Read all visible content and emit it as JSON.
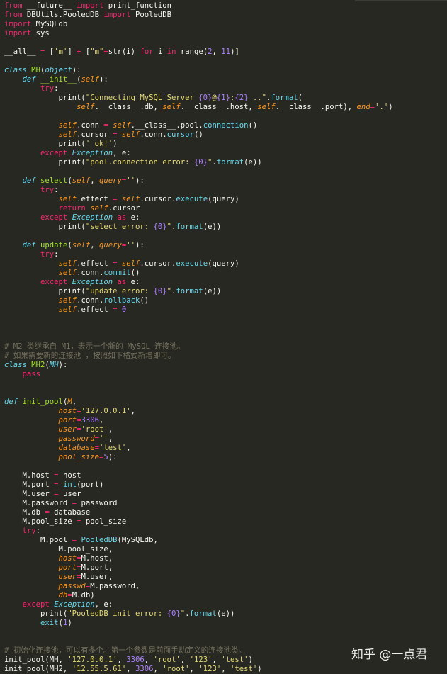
{
  "editor": {
    "theme": "monokai",
    "colors": {
      "background": "#272822",
      "keyword": "#f92672",
      "function": "#a6e22e",
      "builtin": "#66d9ef",
      "string": "#e6db74",
      "number": "#ae81ff",
      "self": "#fd971f",
      "comment": "#75715e",
      "text": "#f8f8f2"
    },
    "lines": [
      [
        [
          "kw",
          "from"
        ],
        [
          "pl",
          " __future__ "
        ],
        [
          "kw",
          "import"
        ],
        [
          "pl",
          " print_function"
        ]
      ],
      [
        [
          "kw",
          "from"
        ],
        [
          "pl",
          " DBUtils.PooledDB "
        ],
        [
          "kw",
          "import"
        ],
        [
          "pl",
          " PooledDB"
        ]
      ],
      [
        [
          "kw",
          "import"
        ],
        [
          "pl",
          " MySQLdb"
        ]
      ],
      [
        [
          "kw",
          "import"
        ],
        [
          "pl",
          " sys"
        ]
      ],
      [],
      [
        [
          "pl",
          "__all__ "
        ],
        [
          "op",
          "="
        ],
        [
          "pl",
          " ["
        ],
        [
          "str",
          "'m'"
        ],
        [
          "pl",
          "] "
        ],
        [
          "op",
          "+"
        ],
        [
          "pl",
          " ["
        ],
        [
          "str",
          "\"m\""
        ],
        [
          "op",
          "+"
        ],
        [
          "pl",
          "str(i) "
        ],
        [
          "kw",
          "for"
        ],
        [
          "pl",
          " i "
        ],
        [
          "kw",
          "in"
        ],
        [
          "pl",
          " range("
        ],
        [
          "num",
          "2"
        ],
        [
          "pl",
          ", "
        ],
        [
          "num",
          "11"
        ],
        [
          "pl",
          ")]"
        ]
      ],
      [],
      [
        [
          "cls",
          "class"
        ],
        [
          "pl",
          " "
        ],
        [
          "fn",
          "MH"
        ],
        [
          "pl",
          "("
        ],
        [
          "cls",
          "object"
        ],
        [
          "pl",
          "):"
        ]
      ],
      [
        [
          "pl",
          "    "
        ],
        [
          "cls",
          "def"
        ],
        [
          "pl",
          " "
        ],
        [
          "fn",
          "__init__"
        ],
        [
          "pl",
          "("
        ],
        [
          "slf",
          "self"
        ],
        [
          "pl",
          "):"
        ]
      ],
      [
        [
          "pl",
          "        "
        ],
        [
          "kw",
          "try"
        ],
        [
          "pl",
          ":"
        ]
      ],
      [
        [
          "pl",
          "            print("
        ],
        [
          "str",
          "\"Connecting MySQL Server "
        ],
        [
          "ph",
          "{0}"
        ],
        [
          "str",
          "@"
        ],
        [
          "ph",
          "{1}"
        ],
        [
          "str",
          ":"
        ],
        [
          "ph",
          "{2}"
        ],
        [
          "str",
          " ..\""
        ],
        [
          "pl",
          "."
        ],
        [
          "bi",
          "format"
        ],
        [
          "pl",
          "("
        ]
      ],
      [
        [
          "pl",
          "                "
        ],
        [
          "slf",
          "self"
        ],
        [
          "pl",
          ".__class__.db, "
        ],
        [
          "slf",
          "self"
        ],
        [
          "pl",
          ".__class__.host, "
        ],
        [
          "slf",
          "self"
        ],
        [
          "pl",
          ".__class__.port), "
        ],
        [
          "prm",
          "end"
        ],
        [
          "op",
          "="
        ],
        [
          "str",
          "'.'"
        ],
        [
          "pl",
          ")"
        ]
      ],
      [],
      [
        [
          "pl",
          "            "
        ],
        [
          "slf",
          "self"
        ],
        [
          "pl",
          ".conn "
        ],
        [
          "op",
          "="
        ],
        [
          "pl",
          " "
        ],
        [
          "slf",
          "self"
        ],
        [
          "pl",
          ".__class__.pool."
        ],
        [
          "bi",
          "connection"
        ],
        [
          "pl",
          "()"
        ]
      ],
      [
        [
          "pl",
          "            "
        ],
        [
          "slf",
          "self"
        ],
        [
          "pl",
          ".cursor "
        ],
        [
          "op",
          "="
        ],
        [
          "pl",
          " "
        ],
        [
          "slf",
          "self"
        ],
        [
          "pl",
          ".conn."
        ],
        [
          "bi",
          "cursor"
        ],
        [
          "pl",
          "()"
        ]
      ],
      [
        [
          "pl",
          "            print("
        ],
        [
          "str",
          "' ok!'"
        ],
        [
          "pl",
          ")"
        ]
      ],
      [
        [
          "pl",
          "        "
        ],
        [
          "kw",
          "except"
        ],
        [
          "pl",
          " "
        ],
        [
          "cls",
          "Exception"
        ],
        [
          "pl",
          ", e:"
        ]
      ],
      [
        [
          "pl",
          "            print("
        ],
        [
          "str",
          "\"pool.connection error: "
        ],
        [
          "ph",
          "{0}"
        ],
        [
          "str",
          "\""
        ],
        [
          "pl",
          "."
        ],
        [
          "bi",
          "format"
        ],
        [
          "pl",
          "(e))"
        ]
      ],
      [],
      [
        [
          "pl",
          "    "
        ],
        [
          "cls",
          "def"
        ],
        [
          "pl",
          " "
        ],
        [
          "fn",
          "select"
        ],
        [
          "pl",
          "("
        ],
        [
          "slf",
          "self"
        ],
        [
          "pl",
          ", "
        ],
        [
          "prm",
          "query"
        ],
        [
          "op",
          "="
        ],
        [
          "str",
          "''"
        ],
        [
          "pl",
          "):"
        ]
      ],
      [
        [
          "pl",
          "        "
        ],
        [
          "kw",
          "try"
        ],
        [
          "pl",
          ":"
        ]
      ],
      [
        [
          "pl",
          "            "
        ],
        [
          "slf",
          "self"
        ],
        [
          "pl",
          ".effect "
        ],
        [
          "op",
          "="
        ],
        [
          "pl",
          " "
        ],
        [
          "slf",
          "self"
        ],
        [
          "pl",
          ".cursor."
        ],
        [
          "bi",
          "execute"
        ],
        [
          "pl",
          "(query)"
        ]
      ],
      [
        [
          "pl",
          "            "
        ],
        [
          "kw",
          "return"
        ],
        [
          "pl",
          " "
        ],
        [
          "slf",
          "self"
        ],
        [
          "pl",
          ".cursor"
        ]
      ],
      [
        [
          "pl",
          "        "
        ],
        [
          "kw",
          "except"
        ],
        [
          "pl",
          " "
        ],
        [
          "cls",
          "Exception"
        ],
        [
          "pl",
          " "
        ],
        [
          "kw",
          "as"
        ],
        [
          "pl",
          " e:"
        ]
      ],
      [
        [
          "pl",
          "            print("
        ],
        [
          "str",
          "\"select error: "
        ],
        [
          "ph",
          "{0}"
        ],
        [
          "str",
          "\""
        ],
        [
          "pl",
          "."
        ],
        [
          "bi",
          "format"
        ],
        [
          "pl",
          "(e))"
        ]
      ],
      [],
      [
        [
          "pl",
          "    "
        ],
        [
          "cls",
          "def"
        ],
        [
          "pl",
          " "
        ],
        [
          "fn",
          "update"
        ],
        [
          "pl",
          "("
        ],
        [
          "slf",
          "self"
        ],
        [
          "pl",
          ", "
        ],
        [
          "prm",
          "query"
        ],
        [
          "op",
          "="
        ],
        [
          "str",
          "''"
        ],
        [
          "pl",
          "):"
        ]
      ],
      [
        [
          "pl",
          "        "
        ],
        [
          "kw",
          "try"
        ],
        [
          "pl",
          ":"
        ]
      ],
      [
        [
          "pl",
          "            "
        ],
        [
          "slf",
          "self"
        ],
        [
          "pl",
          ".effect "
        ],
        [
          "op",
          "="
        ],
        [
          "pl",
          " "
        ],
        [
          "slf",
          "self"
        ],
        [
          "pl",
          ".cursor."
        ],
        [
          "bi",
          "execute"
        ],
        [
          "pl",
          "(query)"
        ]
      ],
      [
        [
          "pl",
          "            "
        ],
        [
          "slf",
          "self"
        ],
        [
          "pl",
          ".conn."
        ],
        [
          "bi",
          "commit"
        ],
        [
          "pl",
          "()"
        ]
      ],
      [
        [
          "pl",
          "        "
        ],
        [
          "kw",
          "except"
        ],
        [
          "pl",
          " "
        ],
        [
          "cls",
          "Exception"
        ],
        [
          "pl",
          " "
        ],
        [
          "kw",
          "as"
        ],
        [
          "pl",
          " e:"
        ]
      ],
      [
        [
          "pl",
          "            print("
        ],
        [
          "str",
          "\"update error: "
        ],
        [
          "ph",
          "{0}"
        ],
        [
          "str",
          "\""
        ],
        [
          "pl",
          "."
        ],
        [
          "bi",
          "format"
        ],
        [
          "pl",
          "(e))"
        ]
      ],
      [
        [
          "pl",
          "            "
        ],
        [
          "slf",
          "self"
        ],
        [
          "pl",
          ".conn."
        ],
        [
          "bi",
          "rollback"
        ],
        [
          "pl",
          "()"
        ]
      ],
      [
        [
          "pl",
          "            "
        ],
        [
          "slf",
          "self"
        ],
        [
          "pl",
          ".effect "
        ],
        [
          "op",
          "="
        ],
        [
          "pl",
          " "
        ],
        [
          "num",
          "0"
        ]
      ],
      [],
      [],
      [],
      [
        [
          "com",
          "# M2 类继承自 M1，表示一个新的 MySQL 连接池。"
        ]
      ],
      [
        [
          "com",
          "# 如果需要新的连接池 ，按照如下格式新增即可。"
        ]
      ],
      [
        [
          "cls",
          "class"
        ],
        [
          "pl",
          " "
        ],
        [
          "fn",
          "MH2"
        ],
        [
          "pl",
          "("
        ],
        [
          "cls",
          "MH"
        ],
        [
          "pl",
          "):"
        ]
      ],
      [
        [
          "pl",
          "    "
        ],
        [
          "kw",
          "pass"
        ]
      ],
      [],
      [],
      [
        [
          "cls",
          "def"
        ],
        [
          "pl",
          " "
        ],
        [
          "fn",
          "init_pool"
        ],
        [
          "pl",
          "("
        ],
        [
          "prm",
          "M"
        ],
        [
          "pl",
          ","
        ]
      ],
      [
        [
          "pl",
          "            "
        ],
        [
          "prm",
          "host"
        ],
        [
          "op",
          "="
        ],
        [
          "str",
          "'127.0.0.1'"
        ],
        [
          "pl",
          ","
        ]
      ],
      [
        [
          "pl",
          "            "
        ],
        [
          "prm",
          "port"
        ],
        [
          "op",
          "="
        ],
        [
          "num",
          "3306"
        ],
        [
          "pl",
          ","
        ]
      ],
      [
        [
          "pl",
          "            "
        ],
        [
          "prm",
          "user"
        ],
        [
          "op",
          "="
        ],
        [
          "str",
          "'root'"
        ],
        [
          "pl",
          ","
        ]
      ],
      [
        [
          "pl",
          "            "
        ],
        [
          "prm",
          "password"
        ],
        [
          "op",
          "="
        ],
        [
          "str",
          "''"
        ],
        [
          "pl",
          ","
        ]
      ],
      [
        [
          "pl",
          "            "
        ],
        [
          "prm",
          "database"
        ],
        [
          "op",
          "="
        ],
        [
          "str",
          "'test'"
        ],
        [
          "pl",
          ","
        ]
      ],
      [
        [
          "pl",
          "            "
        ],
        [
          "prm",
          "pool_size"
        ],
        [
          "op",
          "="
        ],
        [
          "num",
          "5"
        ],
        [
          "pl",
          "):"
        ]
      ],
      [],
      [
        [
          "pl",
          "    M.host "
        ],
        [
          "op",
          "="
        ],
        [
          "pl",
          " host"
        ]
      ],
      [
        [
          "pl",
          "    M.port "
        ],
        [
          "op",
          "="
        ],
        [
          "pl",
          " "
        ],
        [
          "bi",
          "int"
        ],
        [
          "pl",
          "(port)"
        ]
      ],
      [
        [
          "pl",
          "    M.user "
        ],
        [
          "op",
          "="
        ],
        [
          "pl",
          " user"
        ]
      ],
      [
        [
          "pl",
          "    M.password "
        ],
        [
          "op",
          "="
        ],
        [
          "pl",
          " password"
        ]
      ],
      [
        [
          "pl",
          "    M.db "
        ],
        [
          "op",
          "="
        ],
        [
          "pl",
          " database"
        ]
      ],
      [
        [
          "pl",
          "    M.pool_size "
        ],
        [
          "op",
          "="
        ],
        [
          "pl",
          " pool_size"
        ]
      ],
      [
        [
          "pl",
          "    "
        ],
        [
          "kw",
          "try"
        ],
        [
          "pl",
          ":"
        ]
      ],
      [
        [
          "pl",
          "        M.pool "
        ],
        [
          "op",
          "="
        ],
        [
          "pl",
          " "
        ],
        [
          "bi",
          "PooledDB"
        ],
        [
          "pl",
          "(MySQLdb,"
        ]
      ],
      [
        [
          "pl",
          "            M.pool_size,"
        ]
      ],
      [
        [
          "pl",
          "            "
        ],
        [
          "prm",
          "host"
        ],
        [
          "op",
          "="
        ],
        [
          "pl",
          "M.host,"
        ]
      ],
      [
        [
          "pl",
          "            "
        ],
        [
          "prm",
          "port"
        ],
        [
          "op",
          "="
        ],
        [
          "pl",
          "M.port,"
        ]
      ],
      [
        [
          "pl",
          "            "
        ],
        [
          "prm",
          "user"
        ],
        [
          "op",
          "="
        ],
        [
          "pl",
          "M.user,"
        ]
      ],
      [
        [
          "pl",
          "            "
        ],
        [
          "prm",
          "passwd"
        ],
        [
          "op",
          "="
        ],
        [
          "pl",
          "M.password,"
        ]
      ],
      [
        [
          "pl",
          "            "
        ],
        [
          "prm",
          "db"
        ],
        [
          "op",
          "="
        ],
        [
          "pl",
          "M.db)"
        ]
      ],
      [
        [
          "pl",
          "    "
        ],
        [
          "kw",
          "except"
        ],
        [
          "pl",
          " "
        ],
        [
          "cls",
          "Exception"
        ],
        [
          "pl",
          ", e:"
        ]
      ],
      [
        [
          "pl",
          "        print("
        ],
        [
          "str",
          "\"PooledDB init error: "
        ],
        [
          "ph",
          "{0}"
        ],
        [
          "str",
          "\""
        ],
        [
          "pl",
          "."
        ],
        [
          "bi",
          "format"
        ],
        [
          "pl",
          "(e))"
        ]
      ],
      [
        [
          "pl",
          "        "
        ],
        [
          "bi",
          "exit"
        ],
        [
          "pl",
          "("
        ],
        [
          "num",
          "1"
        ],
        [
          "pl",
          ")"
        ]
      ],
      [],
      [],
      [
        [
          "com",
          "# 初始化连接池，可以有多个。第一个参数是前面手动定义的连接池类。"
        ]
      ],
      [
        [
          "pl",
          "init_pool(MH, "
        ],
        [
          "str",
          "'127.0.0.1'"
        ],
        [
          "pl",
          ", "
        ],
        [
          "num",
          "3306"
        ],
        [
          "pl",
          ", "
        ],
        [
          "str",
          "'root'"
        ],
        [
          "pl",
          ", "
        ],
        [
          "str",
          "'123'"
        ],
        [
          "pl",
          ", "
        ],
        [
          "str",
          "'test'"
        ],
        [
          "pl",
          ")"
        ]
      ],
      [
        [
          "pl",
          "init_pool(MH2, "
        ],
        [
          "str",
          "'12.55.5.61'"
        ],
        [
          "pl",
          ", "
        ],
        [
          "num",
          "3306"
        ],
        [
          "pl",
          ", "
        ],
        [
          "str",
          "'root'"
        ],
        [
          "pl",
          ", "
        ],
        [
          "str",
          "'123'"
        ],
        [
          "pl",
          ", "
        ],
        [
          "str",
          "'test'"
        ],
        [
          "pl",
          ")"
        ]
      ]
    ]
  },
  "watermark": {
    "text": "知乎 @一点君"
  }
}
